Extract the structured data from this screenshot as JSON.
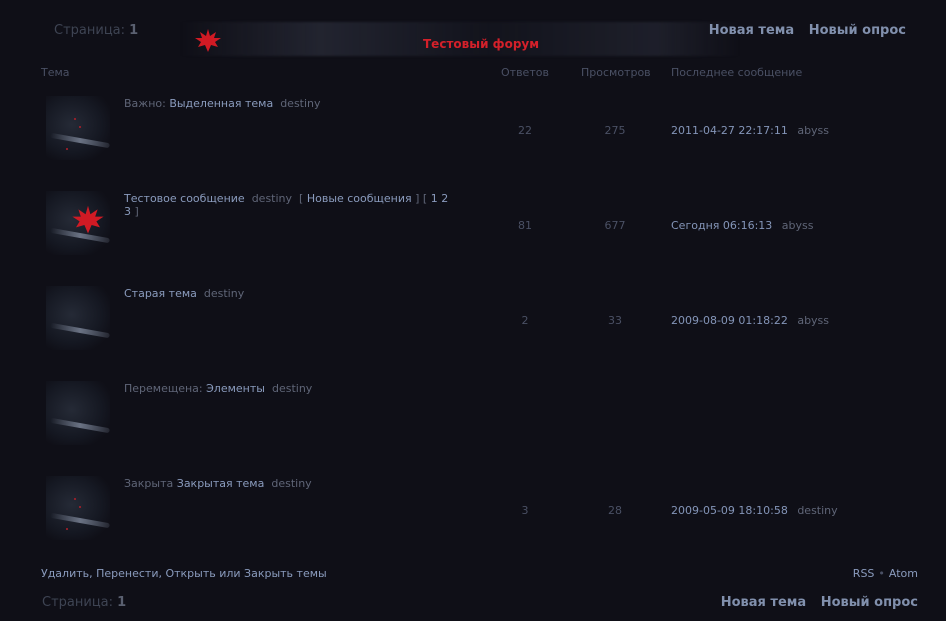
{
  "pagination": {
    "label": "Страница:",
    "current": "1"
  },
  "forum": {
    "title": "Тестовый форум"
  },
  "actions": {
    "new_topic": "Новая тема",
    "new_poll": "Новый опрос"
  },
  "columns": {
    "topic": "Тема",
    "replies": "Ответов",
    "views": "Просмотров",
    "last_post": "Последнее сообщение"
  },
  "topics": [
    {
      "prefix": "Важно:",
      "title": "Выделенная тема",
      "author": "destiny",
      "replies": "22",
      "views": "275",
      "last_date": "2011-04-27 22:17:11",
      "last_user": "abyss",
      "icon": "sticky-topic-icon"
    },
    {
      "prefix": "",
      "title": "Тестовое сообщение",
      "author": "destiny",
      "extra": "[ Новые сообщения ] [ 1 2 3 ]",
      "new_posts": "Новые сообщения",
      "pages": [
        "1",
        "2",
        "3"
      ],
      "replies": "81",
      "views": "677",
      "last_date": "Сегодня 06:16:13",
      "last_user": "abyss",
      "icon": "new-posts-leaf-icon"
    },
    {
      "prefix": "",
      "title": "Старая тема",
      "author": "destiny",
      "replies": "2",
      "views": "33",
      "last_date": "2009-08-09 01:18:22",
      "last_user": "abyss",
      "icon": "normal-topic-icon"
    },
    {
      "prefix": "Перемещена:",
      "title": "Элементы",
      "author": "destiny",
      "replies": "",
      "views": "",
      "last_date": "",
      "last_user": "",
      "icon": "moved-topic-icon"
    },
    {
      "prefix": "Закрыта",
      "title": "Закрытая тема",
      "author": "destiny",
      "replies": "3",
      "views": "28",
      "last_date": "2009-05-09 18:10:58",
      "last_user": "destiny",
      "icon": "closed-topic-icon"
    }
  ],
  "moderation": {
    "links": "Удалить, Перенести, Открыть или Закрыть темы"
  },
  "feeds": {
    "rss": "RSS",
    "separator": "•",
    "atom": "Atom"
  },
  "colors": {
    "background": "#0f0f17",
    "link": "#8a9bbd",
    "accent": "#d4202a"
  }
}
